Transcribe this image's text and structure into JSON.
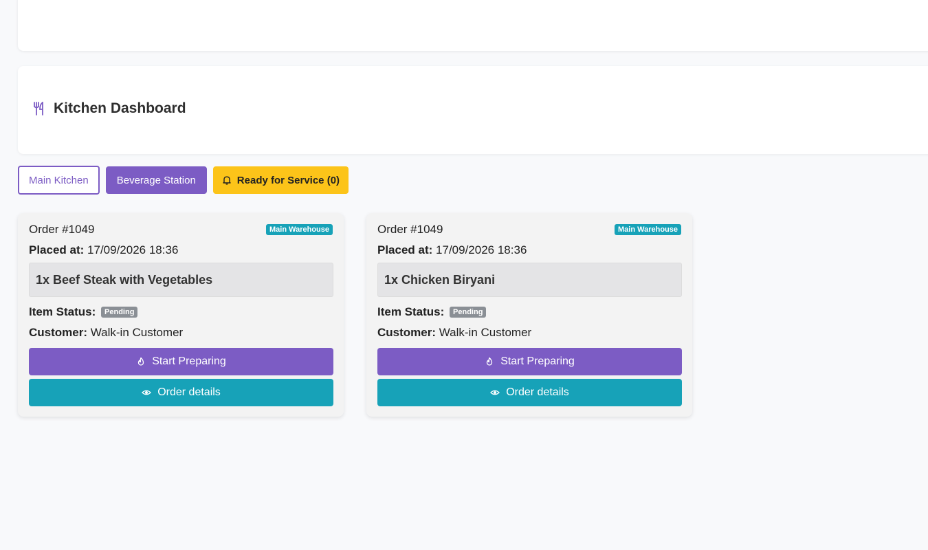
{
  "header": {
    "title": "Kitchen Dashboard",
    "icon": "utensils-icon"
  },
  "tabs": [
    {
      "label": "Main Kitchen"
    },
    {
      "label": "Beverage Station"
    },
    {
      "label": "Ready for Service (0)",
      "icon": "bell-icon"
    }
  ],
  "labels": {
    "placed_at": "Placed at:",
    "item_status": "Item Status:",
    "customer": "Customer:"
  },
  "orders": [
    {
      "order_no": "Order #1049",
      "warehouse": "Main Warehouse",
      "placed_at": "17/09/2026 18:36",
      "item": "1x Beef Steak with Vegetables",
      "status": "Pending",
      "customer": "Walk-in Customer",
      "start_label": "Start Preparing",
      "details_label": "Order details"
    },
    {
      "order_no": "Order #1049",
      "warehouse": "Main Warehouse",
      "placed_at": "17/09/2026 18:36",
      "item": "1x Chicken Biryani",
      "status": "Pending",
      "customer": "Walk-in Customer",
      "start_label": "Start Preparing",
      "details_label": "Order details"
    }
  ],
  "colors": {
    "primary": "#7c5cc4",
    "info": "#17a2b8",
    "warning": "#fcc419",
    "secondary": "#8a8f95"
  }
}
